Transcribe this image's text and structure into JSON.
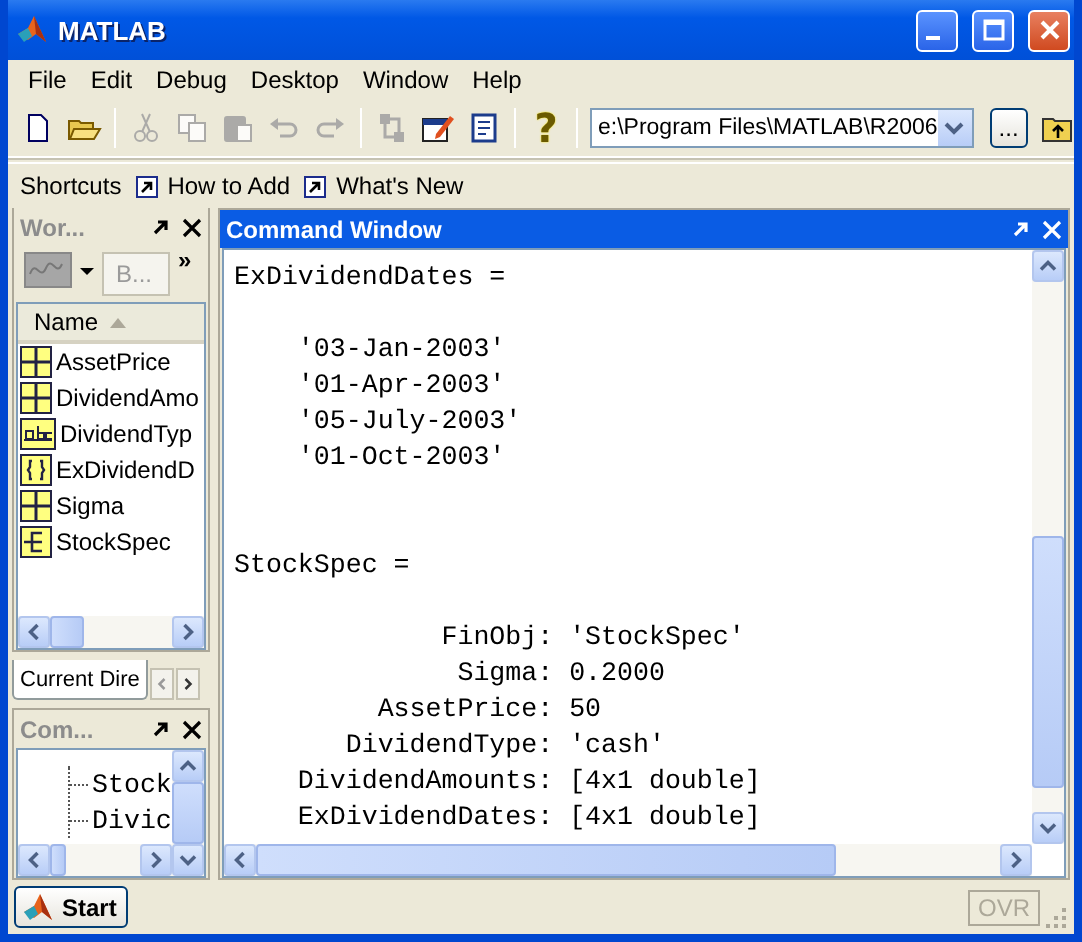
{
  "window": {
    "title": "MATLAB"
  },
  "menu": [
    "File",
    "Edit",
    "Debug",
    "Desktop",
    "Window",
    "Help"
  ],
  "toolbar": {
    "groups": [
      [
        {
          "kind": "new",
          "disabled": false
        },
        {
          "kind": "open",
          "disabled": false
        }
      ],
      [
        {
          "kind": "cut",
          "disabled": true
        },
        {
          "kind": "copy",
          "disabled": true
        },
        {
          "kind": "paste",
          "disabled": true
        },
        {
          "kind": "undo",
          "disabled": true
        },
        {
          "kind": "redo",
          "disabled": true
        }
      ],
      [
        {
          "kind": "simulink",
          "disabled": true
        },
        {
          "kind": "guide",
          "disabled": false
        },
        {
          "kind": "profiler",
          "disabled": false
        }
      ],
      [
        {
          "kind": "help",
          "glyph": "?",
          "disabled": false
        }
      ]
    ],
    "current_folder": {
      "value": "e:\\Program Files\\MATLAB\\R2006",
      "browse_button": "..."
    }
  },
  "shortcuts": {
    "label": "Shortcuts",
    "items": [
      "How to Add",
      "What's New"
    ]
  },
  "workspace": {
    "title": "Wor...",
    "active": false,
    "toolbar_button": "B...",
    "overflow": "»",
    "column": "Name",
    "variables": [
      {
        "name": "AssetPrice",
        "kind": "matrix"
      },
      {
        "name": "DividendAmo",
        "kind": "matrix"
      },
      {
        "name": "DividendTyp",
        "kind": "char"
      },
      {
        "name": "ExDividendD",
        "kind": "cell"
      },
      {
        "name": "Sigma",
        "kind": "matrix"
      },
      {
        "name": "StockSpec",
        "kind": "struct"
      }
    ],
    "tab": "Current Dire"
  },
  "history": {
    "title": "Com...",
    "active": false,
    "lines": [
      "Stock",
      "Divic"
    ]
  },
  "command_window": {
    "title": "Command Window",
    "active": true,
    "outputs": [
      {
        "header": "ExDividendDates =",
        "lines": [
          "    '03-Jan-2003'",
          "    '01-Apr-2003'",
          "    '05-July-2003'",
          "    '01-Oct-2003'"
        ]
      },
      {
        "header": "StockSpec =",
        "lines": [
          "             FinObj: 'StockSpec'",
          "              Sigma: 0.2000",
          "         AssetPrice: 50",
          "       DividendType: 'cash'",
          "    DividendAmounts: [4x1 double]",
          "    ExDividendDates: [4x1 double]"
        ]
      }
    ]
  },
  "status_bar": {
    "start_button": "Start",
    "indicator": {
      "label": "OVR",
      "enabled": false
    }
  }
}
